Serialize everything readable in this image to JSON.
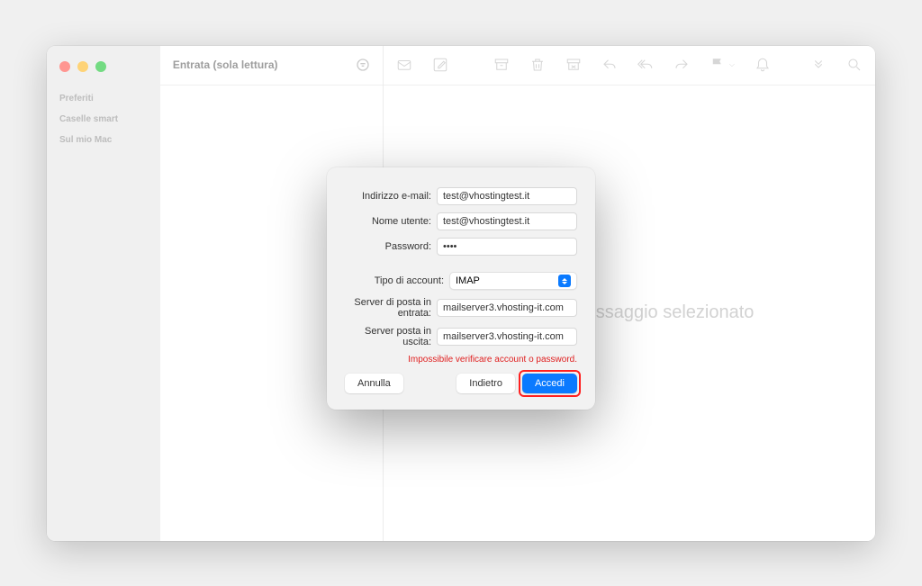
{
  "sidebar": {
    "sections": [
      "Preferiti",
      "Caselle smart",
      "Sul mio Mac"
    ]
  },
  "list": {
    "title": "Entrata (sola lettura)"
  },
  "content": {
    "empty_message": "Nessun messaggio selezionato"
  },
  "dialog": {
    "labels": {
      "email": "Indirizzo e-mail:",
      "username": "Nome utente:",
      "password": "Password:",
      "account_type": "Tipo di account:",
      "incoming": "Server di posta in entrata:",
      "outgoing": "Server posta in uscita:"
    },
    "values": {
      "email": "test@vhostingtest.it",
      "username": "test@vhostingtest.it",
      "password": "••••",
      "account_type": "IMAP",
      "incoming": "mailserver3.vhosting-it.com",
      "outgoing": "mailserver3.vhosting-it.com"
    },
    "error": "Impossibile verificare account o password.",
    "buttons": {
      "cancel": "Annulla",
      "back": "Indietro",
      "login": "Accedi"
    }
  }
}
